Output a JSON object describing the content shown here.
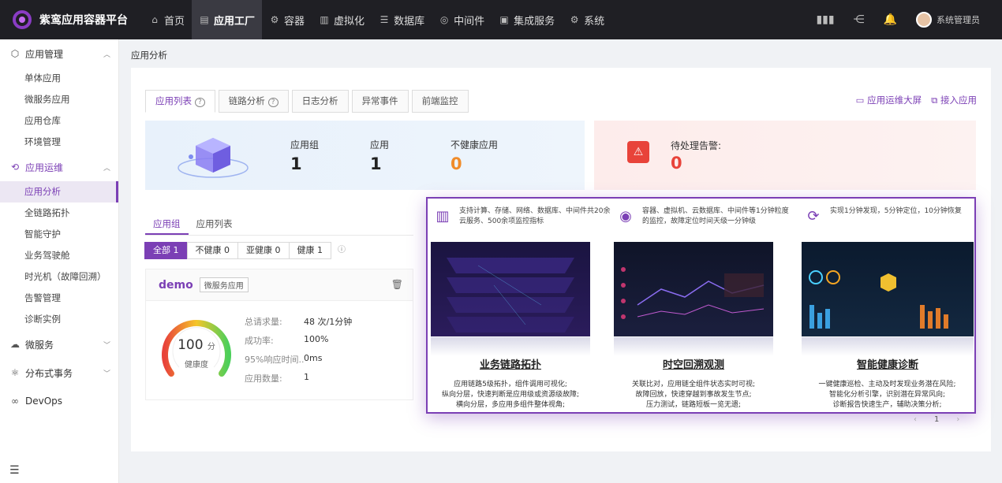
{
  "app": {
    "title": "紫鸾应用容器平台"
  },
  "nav": [
    {
      "icon": "⌂",
      "label": "首页"
    },
    {
      "icon": "▤",
      "label": "应用工厂",
      "active": true
    },
    {
      "icon": "⚙",
      "label": "容器"
    },
    {
      "icon": "▥",
      "label": "虚拟化"
    },
    {
      "icon": "☰",
      "label": "数据库"
    },
    {
      "icon": "◎",
      "label": "中间件"
    },
    {
      "icon": "▣",
      "label": "集成服务"
    },
    {
      "icon": "⚙",
      "label": "系统"
    }
  ],
  "user": {
    "name": "系统管理员"
  },
  "sidebar": {
    "groups": [
      {
        "label": "应用管理",
        "items": [
          "单体应用",
          "微服务应用",
          "应用仓库",
          "环境管理"
        ]
      },
      {
        "label": "应用运维",
        "items": [
          "应用分析",
          "全链路拓扑",
          "智能守护",
          "业务驾驶舱",
          "时光机（故障回溯）",
          "告警管理",
          "诊断实例"
        ]
      },
      {
        "label": "微服务",
        "items": []
      },
      {
        "label": "分布式事务",
        "items": []
      },
      {
        "label": "DevOps",
        "items": []
      }
    ]
  },
  "breadcrumb": "应用分析",
  "tabs": [
    "应用列表",
    "链路分析",
    "日志分析",
    "异常事件",
    "前端监控"
  ],
  "panel_links": [
    "应用运维大屏",
    "接入应用"
  ],
  "stats": {
    "group_label": "应用组",
    "group_value": "1",
    "app_label": "应用",
    "app_value": "1",
    "unhealthy_label": "不健康应用",
    "unhealthy_value": "0",
    "alert_label": "待处理告警:",
    "alert_value": "0"
  },
  "subtabs": [
    "应用组",
    "应用列表"
  ],
  "filters": [
    "全部 1",
    "不健康 0",
    "亚健康 0",
    "健康 1"
  ],
  "app_card": {
    "name": "demo",
    "tag": "微服务应用",
    "gauge_value": "100",
    "gauge_unit": "分",
    "gauge_label": "健康度",
    "rows": [
      {
        "k": "总请求量:",
        "v": "48 次/1分钟"
      },
      {
        "k": "成功率:",
        "v": "100%"
      },
      {
        "k": "95%响应时间...",
        "v": "0ms"
      },
      {
        "k": "应用数量:",
        "v": "1"
      }
    ]
  },
  "promo": [
    {
      "head": "支持计算、存储、网络、数据库、中间件共20余云服务、500余项监控指标",
      "title": "业务链路拓扑",
      "desc": "应用链路5级拓扑，组件调用可视化;\n纵向分层，快速判断是应用级或资源级故障;\n横向分层，多应用多组件整体视角;"
    },
    {
      "head": "容器、虚拟机、云数据库、中间件等1分钟粒度的监控，故障定位时间天级一分钟级",
      "title": "时空回溯观测",
      "desc": "关联比对，应用链全组件状态实时可视;\n故障回放，快速穿越到事故发生节点;\n压力测试，链路短板一览无遗;"
    },
    {
      "head": "实现1分钟发现，5分钟定位，10分钟恢复",
      "title": "智能健康诊断",
      "desc": "一键健康巡检、主动及时发现业务潜在风险;\n智能化分析引擎，识别潜在异常风向;\n诊断报告快速生产，辅助决策分析;"
    }
  ],
  "pager": {
    "current": "1"
  }
}
